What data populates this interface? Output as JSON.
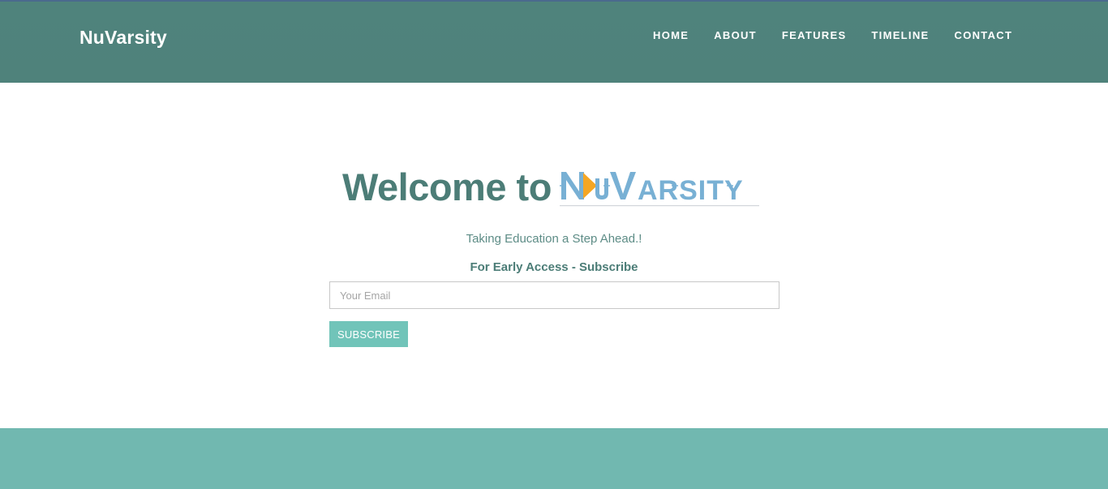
{
  "navbar": {
    "brand": "NuVarsity",
    "items": [
      {
        "label": "HOME"
      },
      {
        "label": "ABOUT"
      },
      {
        "label": "FEATURES"
      },
      {
        "label": "TIMELINE"
      },
      {
        "label": "CONTACT"
      }
    ]
  },
  "hero": {
    "welcome": "Welcome to",
    "logo_text": "NUVARSITY",
    "tagline": "Taking Education a Step Ahead.!",
    "early_access": "For Early Access - Subscribe",
    "email_placeholder": "Your Email",
    "email_value": "",
    "subscribe_label": "SUBSCRIBE"
  },
  "colors": {
    "navbar_bg": "#4f837c",
    "welcome_text": "#4c7d77",
    "logo_blue": "#78b0d4",
    "logo_arrow": "#f5a623",
    "button_bg": "#71c4b9",
    "footer_band": "#71b8b0"
  }
}
